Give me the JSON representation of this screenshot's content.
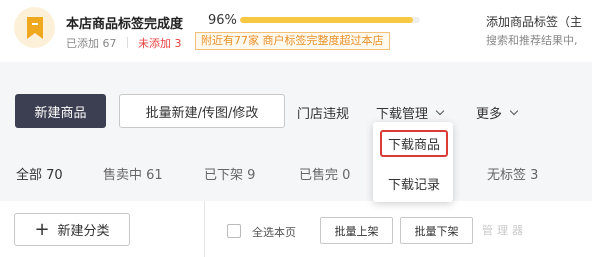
{
  "banner": {
    "title": "本店商品标签完成度",
    "percent_text": "96%",
    "progress_fraction": 0.96,
    "added_text": "已添加 67",
    "not_added_text": "未添加 3",
    "compare_text": "附近有77家 商户标签完整度超过本店",
    "side_title": "添加商品标签（主",
    "side_desc": "搜索和推荐结果中,"
  },
  "toolbar": {
    "new_product": "新建商品",
    "batch_edit": "批量新建/传图/修改",
    "violations": "门店违规",
    "download_manage": "下载管理",
    "more": "更多"
  },
  "tabs": [
    {
      "label": "全部 70",
      "active": true
    },
    {
      "label": "售卖中 61",
      "active": false
    },
    {
      "label": "已下架 9",
      "active": false
    },
    {
      "label": "已售完 0",
      "active": false
    },
    {
      "label": "无标签 3",
      "active": false
    }
  ],
  "bottom": {
    "add_category": "新建分类",
    "select_page": "全选本页",
    "batch_on": "批量上架",
    "batch_off": "批量下架",
    "watermark": "管理器"
  },
  "dropdown": {
    "items": [
      "下载商品",
      "下载记录"
    ],
    "highlight_color": "#d93c35"
  },
  "colors": {
    "primary_button": "#3c3f51",
    "progress": "#f7c843",
    "warning_red": "#e64340",
    "chip_orange": "#e8912a"
  }
}
